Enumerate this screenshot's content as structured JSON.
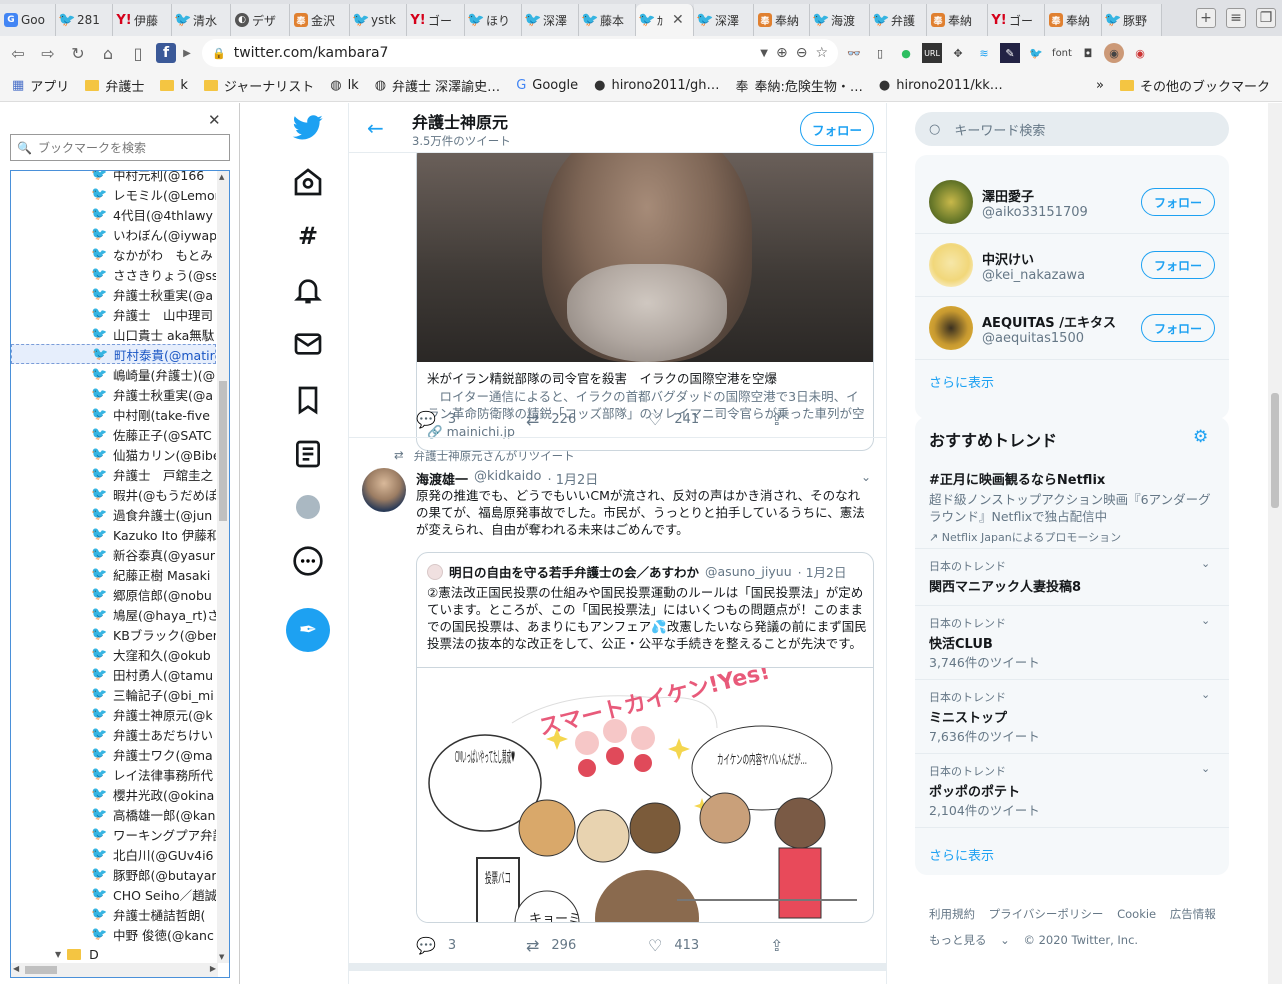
{
  "browser": {
    "tabs": [
      {
        "label": "Goo",
        "icon": "google-docs"
      },
      {
        "label": "281",
        "icon": "twitter"
      },
      {
        "label": "伊藤",
        "icon": "yahoo"
      },
      {
        "label": "清水",
        "icon": "twitter"
      },
      {
        "label": "デザ",
        "icon": "circle"
      },
      {
        "label": "金沢",
        "icon": "hatena"
      },
      {
        "label": "ystk",
        "icon": "twitter"
      },
      {
        "label": "ゴー",
        "icon": "yahoo"
      },
      {
        "label": "ほり",
        "icon": "twitter"
      },
      {
        "label": "深澤",
        "icon": "twitter"
      },
      {
        "label": "藤本",
        "icon": "twitter"
      },
      {
        "label": "ｶ",
        "icon": "twitter",
        "active": true
      },
      {
        "label": "深澤",
        "icon": "twitter"
      },
      {
        "label": "奉納",
        "icon": "hatena"
      },
      {
        "label": "海渡",
        "icon": "twitter"
      },
      {
        "label": "弁護",
        "icon": "twitter"
      },
      {
        "label": "奉納",
        "icon": "hatena"
      },
      {
        "label": "ゴー",
        "icon": "yahoo"
      },
      {
        "label": "奉納",
        "icon": "hatena"
      },
      {
        "label": "豚野",
        "icon": "twitter"
      }
    ],
    "url": "twitter.com/kambara7",
    "bookmarks_bar": [
      {
        "label": "アプリ",
        "icon": "apps-icon"
      },
      {
        "label": "弁護士",
        "icon": "folder"
      },
      {
        "label": "k",
        "icon": "folder"
      },
      {
        "label": "ジャーナリスト",
        "icon": "folder"
      },
      {
        "label": "lk",
        "icon": "globe"
      },
      {
        "label": "弁護士 深澤諭史…",
        "icon": "globe"
      },
      {
        "label": "Google",
        "icon": "google"
      },
      {
        "label": "hirono2011/gh…",
        "icon": "github"
      },
      {
        "label": "奉納:危険生物・…",
        "icon": "hatena"
      },
      {
        "label": "hirono2011/kk…",
        "icon": "github"
      }
    ],
    "other_bookmarks": "その他のブックマーク",
    "extension_font": "font"
  },
  "bookmark_panel": {
    "search_placeholder": "ブックマークを検索",
    "items": [
      "中村元利(@166",
      "レモミル(@Lemor",
      "4代目(@4thlawy",
      "いわぼん(@iywap",
      "なかがわ　もとみ",
      "ささきりょう(@ssk_",
      "弁護士秋重実(@a",
      "弁護士　山中理司",
      "山口貴士 aka無駄",
      "町村泰貴(@matir",
      "嶋崎量(弁護士)(@",
      "弁護士秋重実(@a",
      "中村剛(take-five",
      "佐藤正子(@SATC",
      "仙猫カリン(@Bibe",
      "弁護士　戸舘圭之",
      "暇井(@もうだめぽ(",
      "過食弁護士(@jun",
      "Kazuko Ito 伊藤和",
      "新谷泰真(@yasur",
      "紀藤正樹 Masaki",
      "郷原信郎(@nobu",
      "鳩屋(@haya_rt)さ",
      "KBブラック(@ben",
      "大窪和久(@okub",
      "田村勇人(@tamu",
      "三輪記子(@bi_mi",
      "弁護士神原元(@k",
      "弁護士あだちけい",
      "弁護士ワク(@ma",
      "レイ法律事務所代",
      "櫻井光政(@okina",
      "高橋雄一郎(@kan",
      "ワーキングプア弁護",
      "北白川(@GUv4i6",
      "豚野郎(@butayar",
      "CHO Seiho／趙誠",
      "弁護士樋詰哲朗(",
      "中野 俊徳(@kanc"
    ],
    "selected_index": 9,
    "folder_label": "D"
  },
  "profile": {
    "title": "弁護士神原元",
    "tweet_count": "3.5万件のツイート",
    "follow_label": "フォロー"
  },
  "tweet1": {
    "card_title": "米がイラン精鋭部隊の司令官を殺害　イラクの国際空港を空爆",
    "card_desc": "　ロイター通信によると、イラクの首都バグダッドの国際空港で3日未明、イラン革命防衛隊の精鋭「コッズ部隊」のソレイマニ司令官らが乗った車列が空爆…",
    "card_link": "mainichi.jp",
    "replies": "3",
    "retweets": "226",
    "likes": "241"
  },
  "tweet2": {
    "retweeted_by": "弁護士神原元さんがリツイート",
    "name": "海渡雄一",
    "handle": "@kidkaido",
    "date": "· 1月2日",
    "body": "原発の推進でも、どうでもいいCMが流され、反対の声はかき消され、そのなれの果てが、福島原発事故でした。市民が、うっとりと拍手しているうちに、憲法が変えられ、自由が奪われる未来はごめんです。",
    "quote_name": "明日の自由を守る若手弁護士の会／あすわか",
    "quote_handle": "@asuno_jiyuu",
    "quote_date": "· 1月2日",
    "quote_body": "②憲法改正国民投票の仕組みや国民投票運動のルールは「国民投票法」が定めています。ところが、この「国民投票法」にはいくつもの問題点が！このままでの国民投票は、あまりにもアンフェア💦改憲したいなら発議の前にまず国民投票法の抜本的な改正をして、公正・公平な手続きを整えることが先決です。",
    "illus_title": "スマートカイケン!Yes!",
    "illus_bubble1": "CMいっぱいやってたし賛成♥",
    "illus_bubble2": "カイケンの内容ヤバいんだが…",
    "illus_box": "投票バコ",
    "illus_shirt": "キョーミ",
    "replies": "3",
    "retweets": "296",
    "likes": "413"
  },
  "sidebar": {
    "search_placeholder": "キーワード検索",
    "users": [
      {
        "name": "澤田愛子",
        "handle": "@aiko33151709",
        "follow": "フォロー"
      },
      {
        "name": "中沢けい",
        "handle": "@kei_nakazawa",
        "follow": "フォロー"
      },
      {
        "name": "AEQUITAS /エキタス",
        "handle": "@aequitas1500",
        "follow": "フォロー"
      }
    ],
    "show_more": "さらに表示",
    "trends_title": "おすすめトレンド",
    "promo": {
      "name": "#正月に映画観るならNetflix",
      "desc": "超ド級ノンストップアクション映画『6アンダーグラウンド』Netflixで独占配信中",
      "by": "Netflix Japanによるプロモーション"
    },
    "trends": [
      {
        "context": "日本のトレンド",
        "name": "関西マニアック人妻投稿8",
        "count": ""
      },
      {
        "context": "日本のトレンド",
        "name": "快活CLUB",
        "count": "3,746件のツイート"
      },
      {
        "context": "日本のトレンド",
        "name": "ミニストップ",
        "count": "7,636件のツイート"
      },
      {
        "context": "日本のトレンド",
        "name": "ポッポのポテト",
        "count": "2,104件のツイート"
      }
    ],
    "show_more2": "さらに表示",
    "footer": [
      "利用規約",
      "プライバシーポリシー",
      "Cookie",
      "広告情報",
      "もっと見る",
      "© 2020 Twitter, Inc."
    ]
  }
}
